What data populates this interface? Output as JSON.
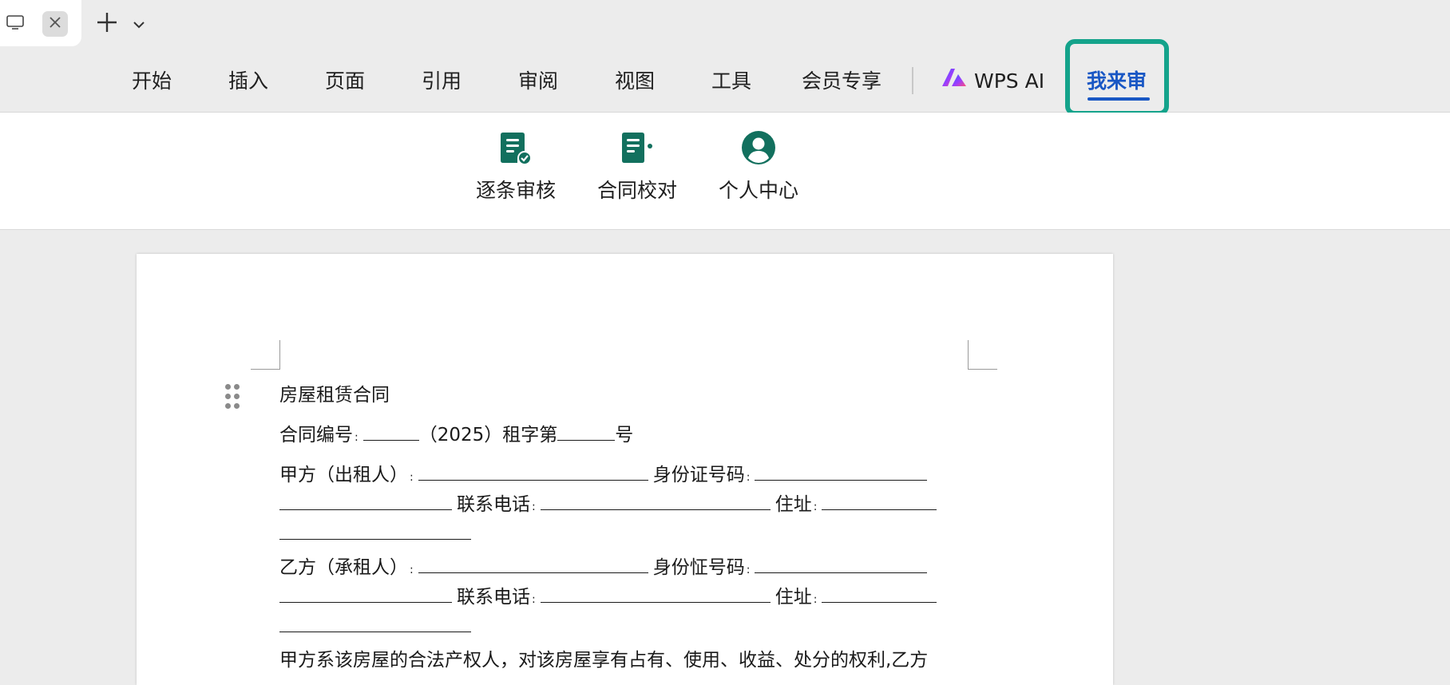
{
  "tabs": {
    "close_icon": "close-icon",
    "new_tab_icon": "plus-icon",
    "more_icon": "chevron-down-icon"
  },
  "menu": {
    "items": [
      "开始",
      "插入",
      "页面",
      "引用",
      "审阅",
      "视图",
      "工具",
      "会员专享"
    ],
    "wps_ai": "WPS AI",
    "active": "我来审",
    "accent_color": "#1957c4",
    "highlight_color": "#14a38b"
  },
  "toolbar": {
    "tools": [
      {
        "label": "逐条审核",
        "icon": "document-check-icon"
      },
      {
        "label": "合同校对",
        "icon": "document-compare-icon"
      },
      {
        "label": "个人中心",
        "icon": "user-circle-icon"
      }
    ],
    "icon_color": "#12705e"
  },
  "document": {
    "title": "房屋租赁合同",
    "contract_no_label": "合同编号",
    "contract_no_mid": "（2025）租字第",
    "contract_no_end": "号",
    "party_a_label": "甲方（出租人）",
    "party_b_label": "乙方（承租人）",
    "id_label_a": "身份证号码",
    "id_label_b": "身份怔号码",
    "phone_label": "联系电话",
    "address_label": "住址",
    "colon": ":",
    "body_start": "甲方系该房屋的合法产权人，对该房屋享有占有、使用、收益、处分的权利,乙方"
  }
}
